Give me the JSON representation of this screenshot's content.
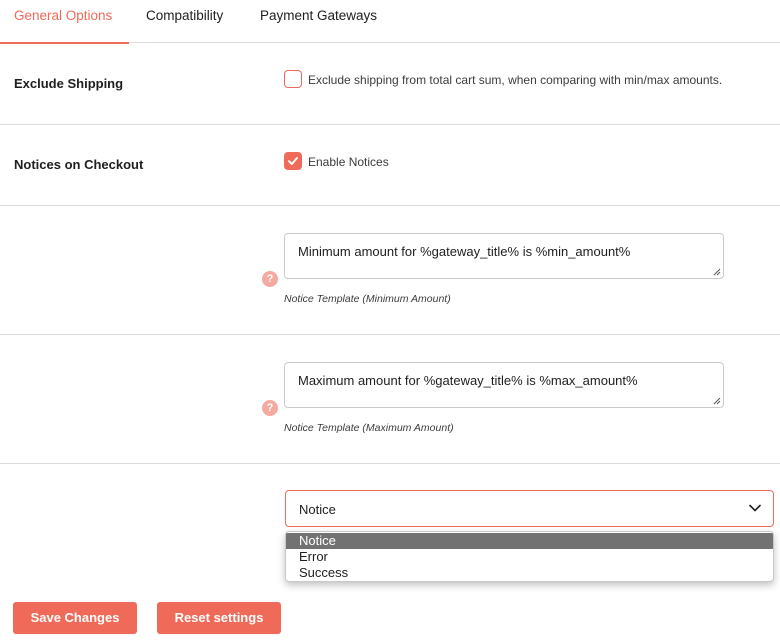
{
  "tabs": [
    {
      "label": "General Options",
      "active": true
    },
    {
      "label": "Compatibility",
      "active": false
    },
    {
      "label": "Payment Gateways",
      "active": false
    }
  ],
  "exclude_shipping": {
    "label": "Exclude Shipping",
    "checkbox_label": "Exclude shipping from total cart sum, when comparing with min/max amounts.",
    "checked": false
  },
  "notices_checkout": {
    "label": "Notices on Checkout",
    "checkbox_label": "Enable Notices",
    "checked": true
  },
  "min_template": {
    "value": "Minimum amount for %gateway_title% is %min_amount%",
    "caption": "Notice Template (Minimum Amount)",
    "help": "?"
  },
  "max_template": {
    "value": "Maximum amount for %gateway_title% is %max_amount%",
    "caption": "Notice Template (Maximum Amount)",
    "help": "?"
  },
  "notice_type": {
    "selected": "Notice",
    "options": [
      "Notice",
      "Error",
      "Success"
    ]
  },
  "buttons": {
    "save": "Save Changes",
    "reset": "Reset settings"
  },
  "colors": {
    "accent": "#f06a5a",
    "help_icon": "#f4a9a1",
    "option_highlight": "#727272"
  },
  "icons": {
    "checkmark": "check-icon",
    "help": "help-icon",
    "dropdown": "chevron-down-icon",
    "resize": "resize-handle-icon"
  }
}
